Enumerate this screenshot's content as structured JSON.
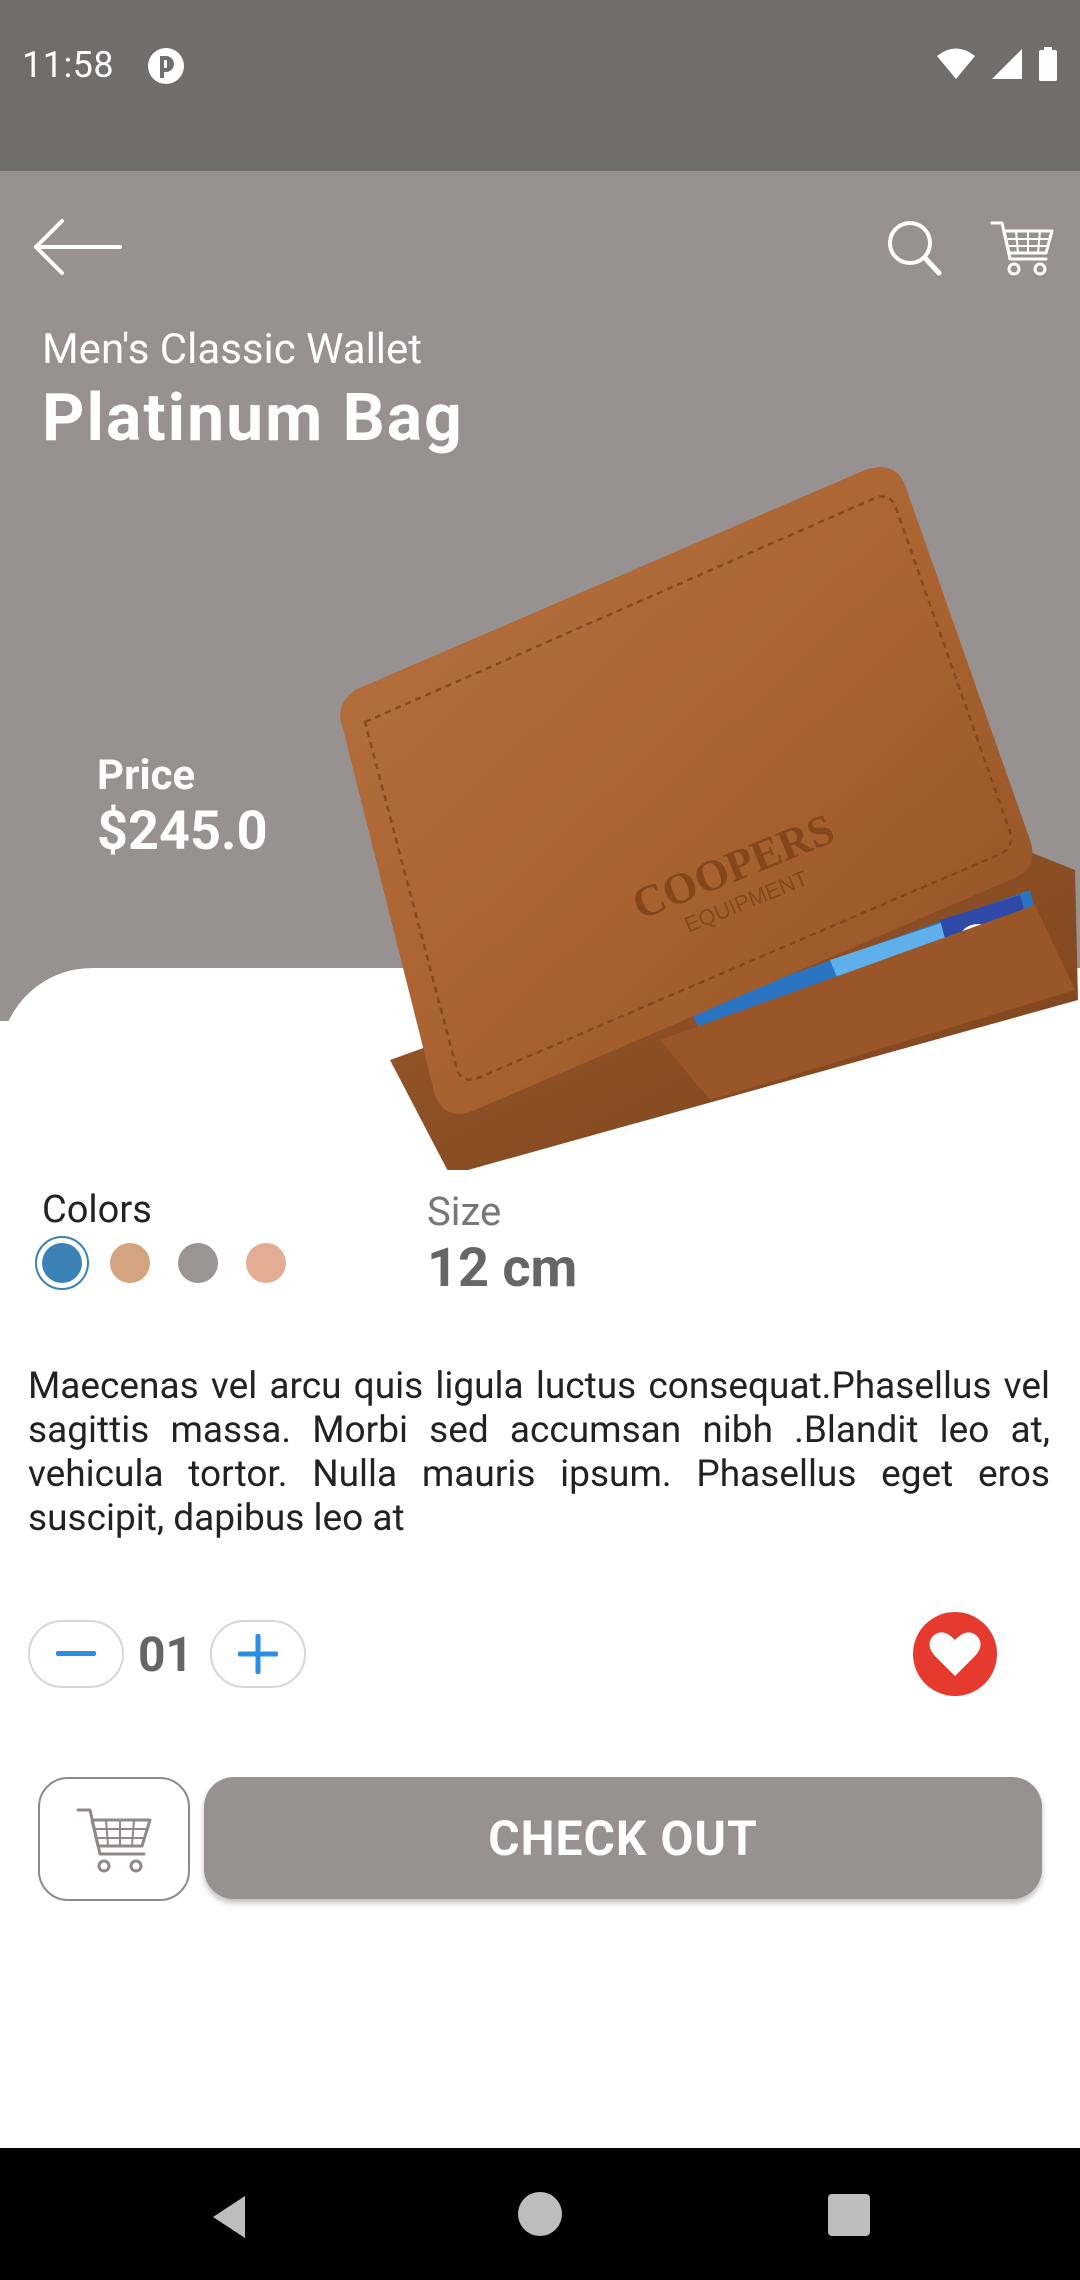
{
  "status_bar": {
    "time": "11:58"
  },
  "header": {
    "subtitle": "Men's Classic Wallet",
    "title": "Platinum Bag"
  },
  "product": {
    "price_label": "Price",
    "price": "$245.0",
    "brand_print": "COOPERS EQUIPMENT"
  },
  "options": {
    "colors_label": "Colors",
    "colors": [
      "#3a82b5",
      "#d3a47f",
      "#9a9494",
      "#e2ad92"
    ],
    "selected_color": "#3a82b5",
    "size_label": "Size",
    "size_value": "12 cm"
  },
  "description": "Maecenas vel arcu quis ligula luctus consequat.Phasellus vel sagittis massa. Morbi sed accumsan nibh .Blandit leo at, vehicula tortor. Nulla mauris ipsum. Phasellus eget eros suscipit, dapibus leo at",
  "quantity": {
    "value": "01"
  },
  "actions": {
    "checkout_label": "CHECK OUT"
  },
  "colors": {
    "hero_bg": "#979191",
    "status_bg": "#706d6d",
    "favorite": "#e63a2f",
    "accent": "#2b8de4"
  }
}
